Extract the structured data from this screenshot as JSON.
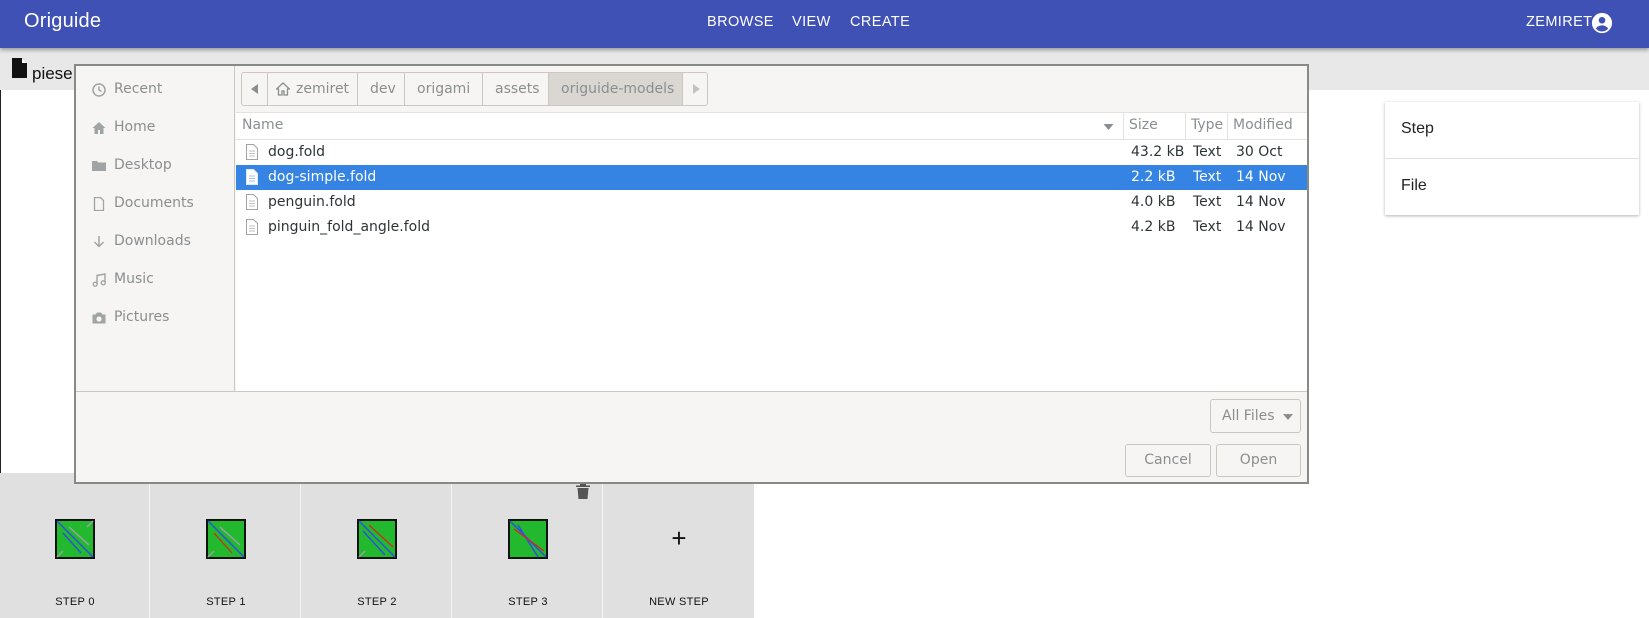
{
  "app": {
    "brand": "Origuide",
    "nav": [
      "BROWSE",
      "VIEW",
      "CREATE"
    ],
    "user": "ZEMIRET"
  },
  "document": {
    "name": "piese"
  },
  "right_panel": {
    "items": [
      "Step",
      "File"
    ]
  },
  "steps": [
    {
      "label": "STEP 0"
    },
    {
      "label": "STEP 1"
    },
    {
      "label": "STEP 2"
    },
    {
      "label": "STEP 3"
    },
    {
      "label": "NEW STEP",
      "icon": "+"
    }
  ],
  "dialog": {
    "places": [
      "Recent",
      "Home",
      "Desktop",
      "Documents",
      "Downloads",
      "Music",
      "Pictures"
    ],
    "path": [
      "zemiret",
      "dev",
      "origami",
      "assets",
      "origuide-models"
    ],
    "active_path": "origuide-models",
    "columns": {
      "name": "Name",
      "size": "Size",
      "type": "Type",
      "modified": "Modified"
    },
    "files": [
      {
        "name": "dog.fold",
        "size": "43.2 kB",
        "type": "Text",
        "modified": "30 Oct"
      },
      {
        "name": "dog-simple.fold",
        "size": "2.2 kB",
        "type": "Text",
        "modified": "14 Nov"
      },
      {
        "name": "penguin.fold",
        "size": "4.0 kB",
        "type": "Text",
        "modified": "14 Nov"
      },
      {
        "name": "pinguin_fold_angle.fold",
        "size": "4.2 kB",
        "type": "Text",
        "modified": "14 Nov"
      }
    ],
    "selected_file": "dog-simple.fold",
    "filter": "All Files",
    "cancel": "Cancel",
    "open": "Open"
  },
  "colors": {
    "appbar": "#3f51b5",
    "selection": "#3584e4",
    "paper_green": "#22b92e",
    "fold_blue": "#3050e0",
    "fold_red": "#e02020"
  }
}
